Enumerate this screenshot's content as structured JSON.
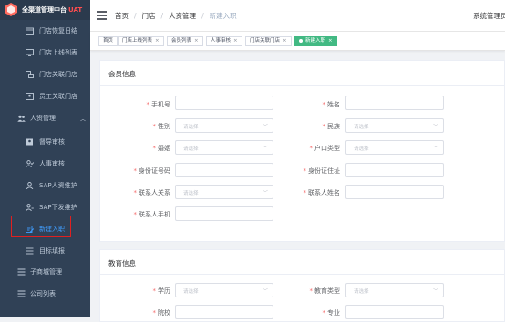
{
  "app": {
    "title": "全渠道管理中台",
    "env": "UAT",
    "system_name": "系统管理员"
  },
  "sidebar": {
    "items": [
      {
        "label": "门店恢复日结",
        "icon": "calendar-icon",
        "level": "sub"
      },
      {
        "label": "门店上线列表",
        "icon": "monitor-icon",
        "level": "sub"
      },
      {
        "label": "门店关联门店",
        "icon": "link-icon",
        "level": "sub"
      },
      {
        "label": "员工关联门店",
        "icon": "user-link-icon",
        "level": "sub"
      },
      {
        "label": "人资管理",
        "icon": "people-icon",
        "level": "top",
        "expanded": true
      },
      {
        "label": "督导审核",
        "icon": "shield-icon",
        "level": "sub"
      },
      {
        "label": "人事审核",
        "icon": "user-check-icon",
        "level": "sub"
      },
      {
        "label": "SAP人资维护",
        "icon": "user-icon",
        "level": "sub"
      },
      {
        "label": "SAP下发维护",
        "icon": "send-icon",
        "level": "sub"
      },
      {
        "label": "新建入职",
        "icon": "edit-icon",
        "level": "sub",
        "active": true
      },
      {
        "label": "目标填报",
        "icon": "list-icon",
        "level": "sub"
      },
      {
        "label": "子商城管理",
        "icon": "list-icon",
        "level": "top"
      },
      {
        "label": "公司列表",
        "icon": "list-icon",
        "level": "top"
      }
    ]
  },
  "breadcrumb": [
    "首页",
    "门店",
    "人资管理",
    "新建入职"
  ],
  "tags": [
    {
      "label": "首页",
      "closable": false
    },
    {
      "label": "门店上线列表",
      "closable": true
    },
    {
      "label": "会员列表",
      "closable": true
    },
    {
      "label": "人事审核",
      "closable": true
    },
    {
      "label": "门店关联门店",
      "closable": true
    },
    {
      "label": "新建入职",
      "closable": true,
      "active": true
    }
  ],
  "member_info": {
    "title": "会员信息",
    "fields": {
      "mobile": {
        "label": "手机号",
        "required": true,
        "value": ""
      },
      "name": {
        "label": "姓名",
        "required": true,
        "value": ""
      },
      "gender": {
        "label": "性别",
        "required": true,
        "placeholder": "请选择"
      },
      "ethnicity": {
        "label": "民族",
        "required": true,
        "placeholder": "请选择"
      },
      "marital": {
        "label": "婚姻",
        "required": true,
        "placeholder": "请选择"
      },
      "hukou_type": {
        "label": "户口类型",
        "required": true,
        "placeholder": "请选择"
      },
      "id_number": {
        "label": "身份证号码",
        "required": true,
        "value": ""
      },
      "id_address": {
        "label": "身份证住址",
        "required": true,
        "value": ""
      },
      "contact_relation": {
        "label": "联系人关系",
        "required": true,
        "placeholder": "请选择"
      },
      "contact_name": {
        "label": "联系人姓名",
        "required": true,
        "value": ""
      },
      "contact_mobile": {
        "label": "联系人手机",
        "required": true,
        "value": ""
      }
    }
  },
  "education_info": {
    "title": "教育信息",
    "fields": {
      "degree": {
        "label": "学历",
        "required": true,
        "placeholder": "请选择"
      },
      "edu_type": {
        "label": "教育类型",
        "required": true,
        "placeholder": "请选择"
      },
      "school": {
        "label": "院校",
        "required": true
      },
      "major": {
        "label": "专业",
        "required": true
      }
    }
  },
  "colors": {
    "sidebar_bg": "#304156",
    "active_tag": "#42b983",
    "active_menu": "#409eff",
    "required": "#f56c6c",
    "highlight": "#e02020"
  }
}
